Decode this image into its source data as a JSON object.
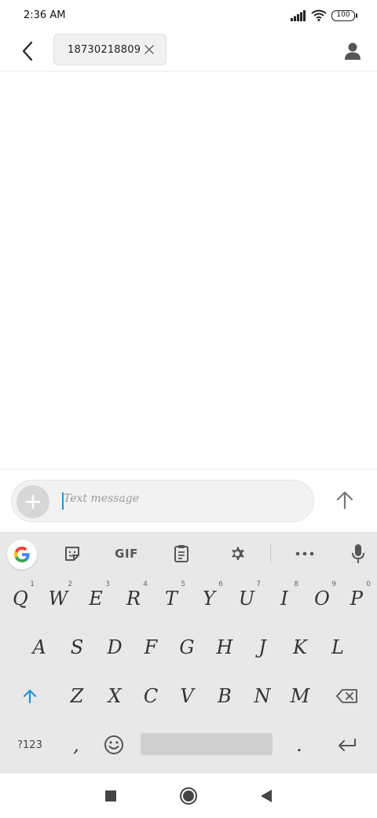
{
  "status_bar": {
    "time": "2:36 AM",
    "battery": "100"
  },
  "header": {
    "recipient": "18730218809"
  },
  "compose": {
    "placeholder": "Text message"
  },
  "keyboard": {
    "toolbar": {
      "gif_label": "GIF"
    },
    "row1": [
      {
        "key": "Q",
        "hint": "1"
      },
      {
        "key": "W",
        "hint": "2"
      },
      {
        "key": "E",
        "hint": "3"
      },
      {
        "key": "R",
        "hint": "4"
      },
      {
        "key": "T",
        "hint": "5"
      },
      {
        "key": "Y",
        "hint": "6"
      },
      {
        "key": "U",
        "hint": "7"
      },
      {
        "key": "I",
        "hint": "8"
      },
      {
        "key": "O",
        "hint": "9"
      },
      {
        "key": "P",
        "hint": "0"
      }
    ],
    "row2": [
      "A",
      "S",
      "D",
      "F",
      "G",
      "H",
      "J",
      "K",
      "L"
    ],
    "row3": [
      "Z",
      "X",
      "C",
      "V",
      "B",
      "N",
      "M"
    ],
    "row4": {
      "symbols": "?123",
      "comma": ",",
      "period": "."
    }
  },
  "colors": {
    "accent": "#2a8fd6",
    "keyboard_bg": "#e8e8e8"
  }
}
